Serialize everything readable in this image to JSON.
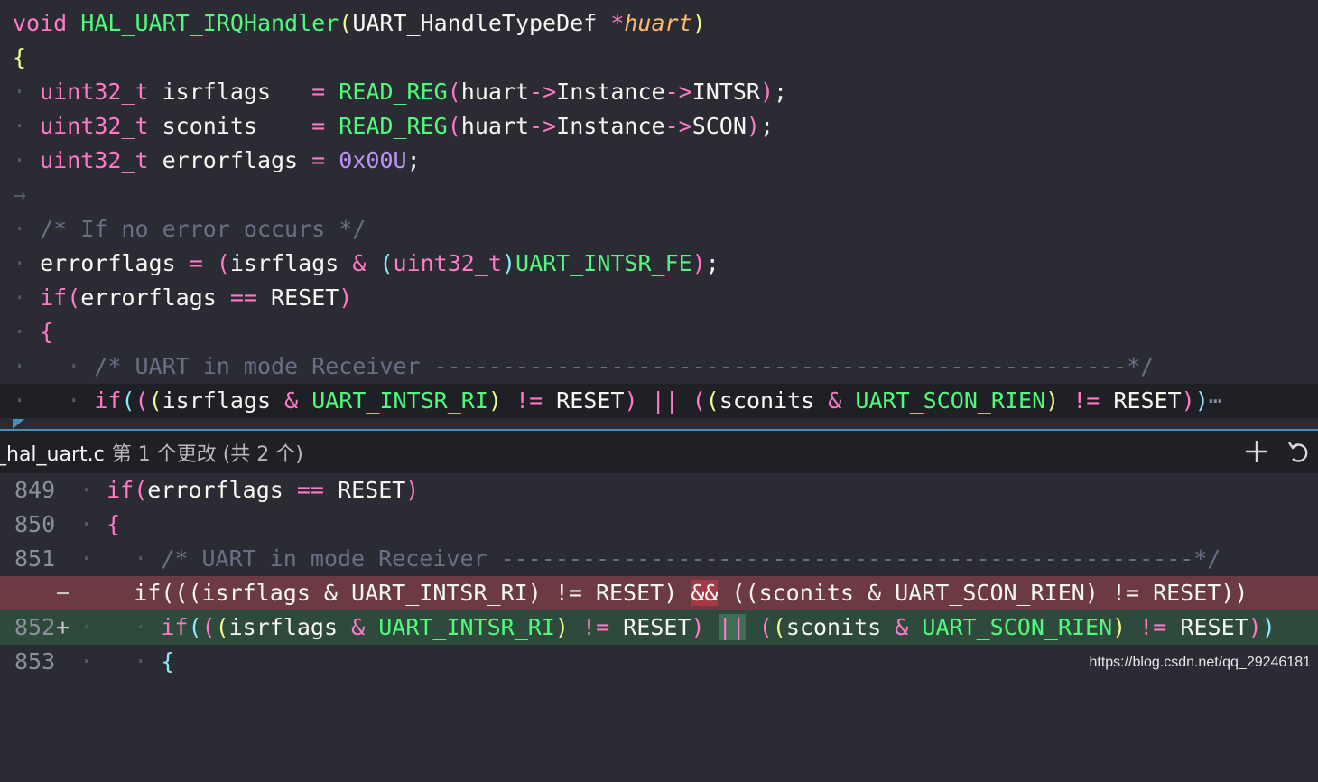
{
  "editor": {
    "lines": [
      {
        "id": "l1",
        "text_parts": [
          "void",
          "HAL_UART_IRQHandler",
          "(",
          "UART_HandleTypeDef",
          "*huart",
          ")"
        ]
      },
      {
        "id": "l2",
        "brace": "{"
      },
      {
        "id": "l3",
        "type": "uint32_t",
        "var": "isrflags",
        "assign": "=",
        "fn": "READ_REG",
        "arg": "huart->Instance->INTSR",
        "end": ");"
      },
      {
        "id": "l4",
        "type": "uint32_t",
        "var": "sconits",
        "assign": "=",
        "fn": "READ_REG",
        "arg": "huart->Instance->SCON",
        "end": ");"
      },
      {
        "id": "l5",
        "type": "uint32_t",
        "var": "errorflags",
        "assign": "=",
        "num": "0x00U",
        "end": ";"
      },
      {
        "id": "l6",
        "arrow": "→"
      },
      {
        "id": "l7",
        "comment": "/* If no error occurs */"
      },
      {
        "id": "l8",
        "text": "errorflags = (isrflags & (uint32_t)UART_INTSR_FE);"
      },
      {
        "id": "l9",
        "text": "if(errorflags == RESET)"
      },
      {
        "id": "l10",
        "brace": "{"
      },
      {
        "id": "l11",
        "comment": "/* UART in mode Receiver ---------------------------------------------------*/"
      },
      {
        "id": "l12",
        "text": "if(((isrflags & UART_INTSR_RI) != RESET) || ((sconits & UART_SCON_RIEN) != RESET))",
        "tail": "⋯"
      }
    ]
  },
  "peek": {
    "file_name": "_hal_uart.c",
    "change_desc": "第 1 个更改 (共 2 个)",
    "add_icon": "plus-icon",
    "revert_icon": "revert-icon"
  },
  "diff": {
    "rows": [
      {
        "ln": "849",
        "marker": "",
        "kind": "normal"
      },
      {
        "ln": "850",
        "marker": "",
        "kind": "normal"
      },
      {
        "ln": "851",
        "marker": "",
        "kind": "normal"
      },
      {
        "ln": "",
        "marker": "−",
        "kind": "del"
      },
      {
        "ln": "852",
        "marker": "+",
        "kind": "add"
      },
      {
        "ln": "853",
        "marker": "",
        "kind": "normal"
      }
    ],
    "del_op": "&&",
    "add_op": "||"
  },
  "watermark": "https://blog.csdn.net/qq_29246181",
  "colors": {
    "keyword": "#ff79c6",
    "function": "#50fa7b",
    "comment": "#6b6f84",
    "deleted_bg": "#6b3a42",
    "added_bg": "#2e4a3c",
    "peek_border": "#4d8fb3"
  }
}
